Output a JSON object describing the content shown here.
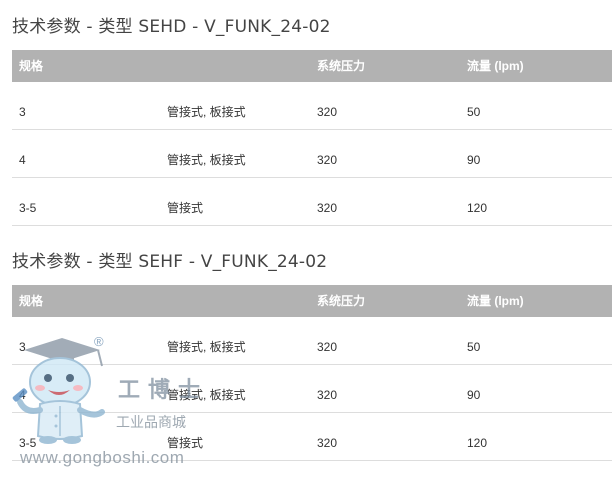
{
  "sections": [
    {
      "title": "技术参数 - 类型 SEHD - V_FUNK_24-02",
      "headers": [
        "规格",
        "",
        "系统压力",
        "流量 (lpm)"
      ],
      "rows": [
        [
          "3",
          "管接式, 板接式",
          "320",
          "50"
        ],
        [
          "4",
          "管接式, 板接式",
          "320",
          "90"
        ],
        [
          "3-5",
          "管接式",
          "320",
          "120"
        ]
      ]
    },
    {
      "title": "技术参数 - 类型 SEHF - V_FUNK_24-02",
      "headers": [
        "规格",
        "",
        "系统压力",
        "流量 (lpm)"
      ],
      "rows": [
        [
          "3",
          "管接式, 板接式",
          "320",
          "50"
        ],
        [
          "4",
          "管接式, 板接式",
          "320",
          "90"
        ],
        [
          "3-5",
          "管接式",
          "320",
          "120"
        ]
      ]
    }
  ],
  "watermark": {
    "brand": "工博士",
    "subtitle": "工业品商城",
    "url": "www.gongboshi.com",
    "registered": "®",
    "icon": "mascot-logo-icon"
  },
  "colors": {
    "header_bg": "#b2b2b2",
    "header_text": "#ffffff",
    "row_divider": "#dddddd"
  }
}
